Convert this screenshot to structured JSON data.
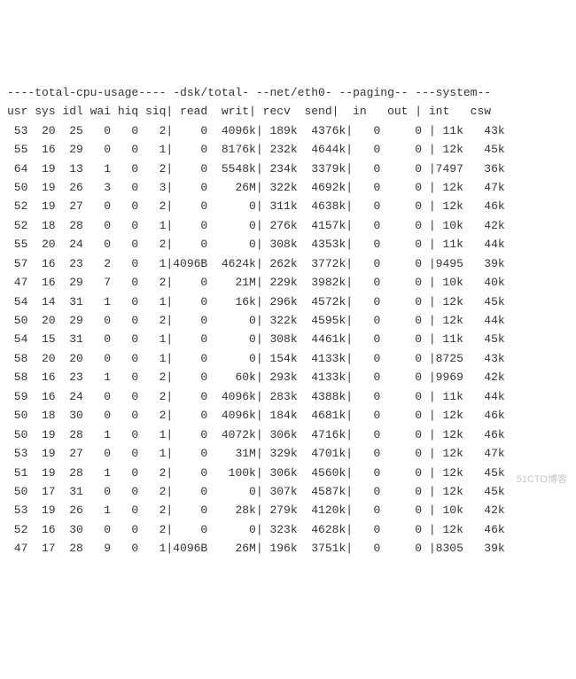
{
  "header1": "----total-cpu-usage---- -dsk/total- --net/eth0- --paging-- ---system--",
  "header2": "usr sys idl wai hiq siq| read  writ| recv  send|  in   out | int   csw",
  "rows": [
    {
      "usr": "53",
      "sys": "20",
      "idl": "25",
      "wai": "0",
      "hiq": "0",
      "siq": "2",
      "read": "0",
      "writ": "4096k",
      "recv": "189k",
      "send": "4376k",
      "in": "0",
      "out": "0",
      "int": "11k",
      "csw": "43k"
    },
    {
      "usr": "55",
      "sys": "16",
      "idl": "29",
      "wai": "0",
      "hiq": "0",
      "siq": "1",
      "read": "0",
      "writ": "8176k",
      "recv": "232k",
      "send": "4644k",
      "in": "0",
      "out": "0",
      "int": "12k",
      "csw": "45k"
    },
    {
      "usr": "64",
      "sys": "19",
      "idl": "13",
      "wai": "1",
      "hiq": "0",
      "siq": "2",
      "read": "0",
      "writ": "5548k",
      "recv": "234k",
      "send": "3379k",
      "in": "0",
      "out": "0",
      "int": "7497",
      "csw": "36k"
    },
    {
      "usr": "50",
      "sys": "19",
      "idl": "26",
      "wai": "3",
      "hiq": "0",
      "siq": "3",
      "read": "0",
      "writ": "26M",
      "recv": "322k",
      "send": "4692k",
      "in": "0",
      "out": "0",
      "int": "12k",
      "csw": "47k"
    },
    {
      "usr": "52",
      "sys": "19",
      "idl": "27",
      "wai": "0",
      "hiq": "0",
      "siq": "2",
      "read": "0",
      "writ": "0",
      "recv": "311k",
      "send": "4638k",
      "in": "0",
      "out": "0",
      "int": "12k",
      "csw": "46k"
    },
    {
      "usr": "52",
      "sys": "18",
      "idl": "28",
      "wai": "0",
      "hiq": "0",
      "siq": "1",
      "read": "0",
      "writ": "0",
      "recv": "276k",
      "send": "4157k",
      "in": "0",
      "out": "0",
      "int": "10k",
      "csw": "42k"
    },
    {
      "usr": "55",
      "sys": "20",
      "idl": "24",
      "wai": "0",
      "hiq": "0",
      "siq": "2",
      "read": "0",
      "writ": "0",
      "recv": "308k",
      "send": "4353k",
      "in": "0",
      "out": "0",
      "int": "11k",
      "csw": "44k"
    },
    {
      "usr": "57",
      "sys": "16",
      "idl": "23",
      "wai": "2",
      "hiq": "0",
      "siq": "1",
      "read": "4096B",
      "writ": "4624k",
      "recv": "262k",
      "send": "3772k",
      "in": "0",
      "out": "0",
      "int": "9495",
      "csw": "39k"
    },
    {
      "usr": "47",
      "sys": "16",
      "idl": "29",
      "wai": "7",
      "hiq": "0",
      "siq": "2",
      "read": "0",
      "writ": "21M",
      "recv": "229k",
      "send": "3982k",
      "in": "0",
      "out": "0",
      "int": "10k",
      "csw": "40k"
    },
    {
      "usr": "54",
      "sys": "14",
      "idl": "31",
      "wai": "1",
      "hiq": "0",
      "siq": "1",
      "read": "0",
      "writ": "16k",
      "recv": "296k",
      "send": "4572k",
      "in": "0",
      "out": "0",
      "int": "12k",
      "csw": "45k"
    },
    {
      "usr": "50",
      "sys": "20",
      "idl": "29",
      "wai": "0",
      "hiq": "0",
      "siq": "2",
      "read": "0",
      "writ": "0",
      "recv": "322k",
      "send": "4595k",
      "in": "0",
      "out": "0",
      "int": "12k",
      "csw": "44k"
    },
    {
      "usr": "54",
      "sys": "15",
      "idl": "31",
      "wai": "0",
      "hiq": "0",
      "siq": "1",
      "read": "0",
      "writ": "0",
      "recv": "308k",
      "send": "4461k",
      "in": "0",
      "out": "0",
      "int": "11k",
      "csw": "45k"
    },
    {
      "usr": "58",
      "sys": "20",
      "idl": "20",
      "wai": "0",
      "hiq": "0",
      "siq": "1",
      "read": "0",
      "writ": "0",
      "recv": "154k",
      "send": "4133k",
      "in": "0",
      "out": "0",
      "int": "8725",
      "csw": "43k"
    },
    {
      "usr": "58",
      "sys": "16",
      "idl": "23",
      "wai": "1",
      "hiq": "0",
      "siq": "2",
      "read": "0",
      "writ": "60k",
      "recv": "293k",
      "send": "4133k",
      "in": "0",
      "out": "0",
      "int": "9969",
      "csw": "42k"
    },
    {
      "usr": "59",
      "sys": "16",
      "idl": "24",
      "wai": "0",
      "hiq": "0",
      "siq": "2",
      "read": "0",
      "writ": "4096k",
      "recv": "283k",
      "send": "4388k",
      "in": "0",
      "out": "0",
      "int": "11k",
      "csw": "44k"
    },
    {
      "usr": "50",
      "sys": "18",
      "idl": "30",
      "wai": "0",
      "hiq": "0",
      "siq": "2",
      "read": "0",
      "writ": "4096k",
      "recv": "184k",
      "send": "4681k",
      "in": "0",
      "out": "0",
      "int": "12k",
      "csw": "46k"
    },
    {
      "usr": "50",
      "sys": "19",
      "idl": "28",
      "wai": "1",
      "hiq": "0",
      "siq": "1",
      "read": "0",
      "writ": "4072k",
      "recv": "306k",
      "send": "4716k",
      "in": "0",
      "out": "0",
      "int": "12k",
      "csw": "46k"
    },
    {
      "usr": "53",
      "sys": "19",
      "idl": "27",
      "wai": "0",
      "hiq": "0",
      "siq": "1",
      "read": "0",
      "writ": "31M",
      "recv": "329k",
      "send": "4701k",
      "in": "0",
      "out": "0",
      "int": "12k",
      "csw": "47k"
    },
    {
      "usr": "51",
      "sys": "19",
      "idl": "28",
      "wai": "1",
      "hiq": "0",
      "siq": "2",
      "read": "0",
      "writ": "100k",
      "recv": "306k",
      "send": "4560k",
      "in": "0",
      "out": "0",
      "int": "12k",
      "csw": "45k"
    },
    {
      "usr": "50",
      "sys": "17",
      "idl": "31",
      "wai": "0",
      "hiq": "0",
      "siq": "2",
      "read": "0",
      "writ": "0",
      "recv": "307k",
      "send": "4587k",
      "in": "0",
      "out": "0",
      "int": "12k",
      "csw": "45k"
    },
    {
      "usr": "53",
      "sys": "19",
      "idl": "26",
      "wai": "1",
      "hiq": "0",
      "siq": "2",
      "read": "0",
      "writ": "28k",
      "recv": "279k",
      "send": "4120k",
      "in": "0",
      "out": "0",
      "int": "10k",
      "csw": "42k"
    },
    {
      "usr": "52",
      "sys": "16",
      "idl": "30",
      "wai": "0",
      "hiq": "0",
      "siq": "2",
      "read": "0",
      "writ": "0",
      "recv": "323k",
      "send": "4628k",
      "in": "0",
      "out": "0",
      "int": "12k",
      "csw": "46k"
    },
    {
      "usr": "47",
      "sys": "17",
      "idl": "28",
      "wai": "9",
      "hiq": "0",
      "siq": "1",
      "read": "4096B",
      "writ": "26M",
      "recv": "196k",
      "send": "3751k",
      "in": "0",
      "out": "0",
      "int": "8305",
      "csw": "39k"
    }
  ],
  "watermark": "51CTO博客"
}
